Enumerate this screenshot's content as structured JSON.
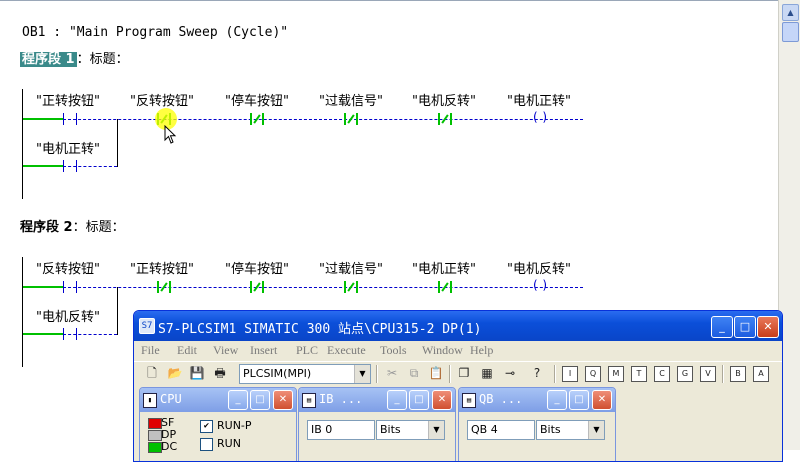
{
  "editor": {
    "header": "OB1 :  \"Main Program Sweep (Cycle)\"",
    "segments": [
      {
        "label_prefix": "程序段",
        "label_num": "1",
        "title_suffix": "：标题：",
        "top_contacts": [
          "\"正转按钮\"",
          "\"反转按钮\"",
          "\"停车按钮\"",
          "\"过载信号\"",
          "\"电机反转\""
        ],
        "coil": "\"电机正转\"",
        "branch_contact": "\"电机正转\""
      },
      {
        "label_prefix": "程序段",
        "label_num": "2",
        "title_suffix": "：标题：",
        "top_contacts": [
          "\"反转按钮\"",
          "\"正转按钮\"",
          "\"停车按钮\"",
          "\"过载信号\"",
          "\"电机正转\""
        ],
        "coil": "\"电机反转\"",
        "branch_contact": "\"电机反转\""
      }
    ]
  },
  "scrollbar": {
    "up_arrow": "▲"
  },
  "plcsim": {
    "icon": "S7",
    "title": "S7-PLCSIM1      SIMATIC 300 站点\\CPU315-2 DP(1)",
    "buttons": {
      "minimize": "_",
      "maximize": "□",
      "close": "✕"
    },
    "menu": [
      "File",
      "Edit",
      "View",
      "Insert",
      "PLC",
      "Execute",
      "Tools",
      "Window",
      "Help"
    ],
    "interface_value": "PLCSIM(MPI)",
    "toolbar_icons": [
      "new-icon",
      "open-icon",
      "save-icon",
      "print-icon",
      "cut-icon",
      "copy-icon",
      "paste-icon",
      "cascade-icon",
      "tile-icon",
      "pin-icon",
      "help-icon",
      "insert-ib-icon",
      "insert-qb-icon",
      "insert-m-icon",
      "insert-t-icon",
      "insert-c-icon",
      "insert-gen-icon",
      "insert-vb-icon",
      "insert-bit-icon",
      "insert-var-icon"
    ]
  },
  "cpu_window": {
    "title": "CPU",
    "leds": [
      {
        "label": "SF",
        "color": "#e00000"
      },
      {
        "label": "DP",
        "color": "#c0c0c0"
      },
      {
        "label": "DC",
        "color": "#00c000"
      }
    ],
    "modes": [
      {
        "label": "RUN-P",
        "checked": true,
        "mark": "✔"
      },
      {
        "label": "RUN",
        "checked": false,
        "mark": ""
      }
    ]
  },
  "ib_window": {
    "title": "IB  ...",
    "address": "IB   0",
    "format": "Bits"
  },
  "qb_window": {
    "title": "QB  ...",
    "address": "QB   4",
    "format": "Bits"
  }
}
